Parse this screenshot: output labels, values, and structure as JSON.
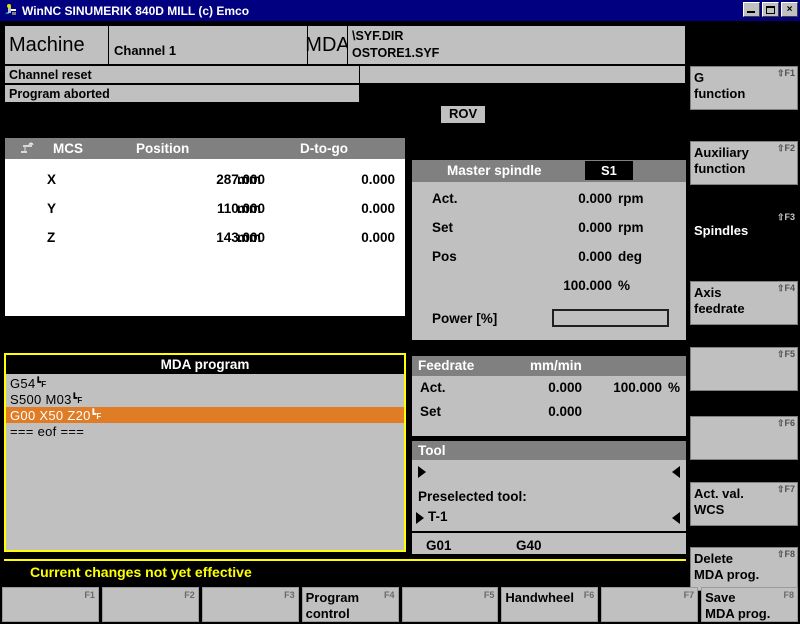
{
  "window": {
    "title": "WinNC SINUMERIK 840D MILL (c) Emco",
    "icon": "app-icon",
    "minimize_label": "_",
    "maximize_label": "□",
    "close_label": "×"
  },
  "header": {
    "mode": "Machine",
    "channel": "Channel 1",
    "operating_mode": "MDA",
    "program_path": "\\SYF.DIR",
    "program_name": "OSTORE1.SYF",
    "channel_status": "Channel reset",
    "program_status": "Program aborted",
    "rov_badge": "ROV"
  },
  "position": {
    "icon": "machine-axis-icon",
    "headers": {
      "coord_system": "MCS",
      "position": "Position",
      "dtogo": "D-to-go"
    },
    "axes": [
      {
        "name": "X",
        "position": "287.000",
        "unit": "mm",
        "dtogo": "0.000"
      },
      {
        "name": "Y",
        "position": "110.000",
        "unit": "mm",
        "dtogo": "0.000"
      },
      {
        "name": "Z",
        "position": "143.000",
        "unit": "mm",
        "dtogo": "0.000"
      }
    ]
  },
  "spindle": {
    "title": "Master spindle",
    "badge": "S1",
    "rows": [
      {
        "label": "Act.",
        "value": "0.000",
        "unit": "rpm"
      },
      {
        "label": "Set",
        "value": "0.000",
        "unit": "rpm"
      },
      {
        "label": "Pos",
        "value": "0.000",
        "unit": "deg"
      },
      {
        "label": "",
        "value": "100.000",
        "unit": "%"
      }
    ],
    "power_label": "Power [%]",
    "power_value": ""
  },
  "mda_program": {
    "title": "MDA program",
    "lines": [
      {
        "text": "G54",
        "lf": true,
        "selected": false
      },
      {
        "text": "S500 M03",
        "lf": true,
        "selected": false
      },
      {
        "text": "G00 X50 Z20",
        "lf": true,
        "selected": true
      },
      {
        "text": "=== eof ===",
        "lf": false,
        "selected": false
      }
    ]
  },
  "feedrate": {
    "title": "Feedrate",
    "unit": "mm/min",
    "rows": [
      {
        "label": "Act.",
        "value": "0.000",
        "percent": "100.000",
        "percent_symbol": "%"
      },
      {
        "label": "Set",
        "value": "0.000",
        "percent": "",
        "percent_symbol": ""
      }
    ]
  },
  "tool": {
    "title": "Tool",
    "current_tool": "",
    "preselected_label": "Preselected tool:",
    "preselected_tool": "T-1",
    "gcode_1": "G01",
    "gcode_2": "G40"
  },
  "status_message": "Current changes not yet effective",
  "vertical_softkeys": [
    {
      "label": "G\nfunction",
      "fkey": "F1",
      "shift": true,
      "active": false
    },
    {
      "label": "Auxiliary\nfunction",
      "fkey": "F2",
      "shift": true,
      "active": false
    },
    {
      "label": "Spindles",
      "fkey": "F3",
      "shift": true,
      "active": true
    },
    {
      "label": "Axis\nfeedrate",
      "fkey": "F4",
      "shift": true,
      "active": false
    },
    {
      "label": "",
      "fkey": "F5",
      "shift": true,
      "active": false
    },
    {
      "label": "",
      "fkey": "F6",
      "shift": true,
      "active": false
    },
    {
      "label": "Act. val.\nWCS",
      "fkey": "F7",
      "shift": true,
      "active": false
    },
    {
      "label": "Delete\nMDA prog.",
      "fkey": "F8",
      "shift": true,
      "active": false
    }
  ],
  "horizontal_softkeys": [
    {
      "label": "",
      "fkey": "F1"
    },
    {
      "label": "",
      "fkey": "F2"
    },
    {
      "label": "",
      "fkey": "F3"
    },
    {
      "label": "Program\ncontrol",
      "fkey": "F4"
    },
    {
      "label": "",
      "fkey": "F5"
    },
    {
      "label": "Handwheel",
      "fkey": "F6"
    },
    {
      "label": "",
      "fkey": "F7"
    },
    {
      "label": "Save\nMDA prog.",
      "fkey": "F8"
    }
  ],
  "colors": {
    "title_bar": "#000080",
    "panel_gray": "#c0c0c0",
    "panel_header_gray": "#808080",
    "highlight_orange": "#e07b26",
    "accent_yellow": "#ffff00",
    "background": "#000000"
  }
}
